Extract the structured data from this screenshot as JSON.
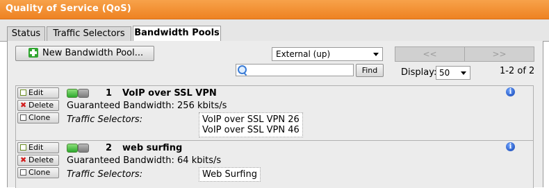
{
  "window": {
    "title": "Quality of Service (QoS)"
  },
  "tabs": [
    {
      "label": "Status"
    },
    {
      "label": "Traffic Selectors"
    },
    {
      "label": "Bandwidth Pools",
      "active": true
    }
  ],
  "toolbar": {
    "new_pool_label": "New Bandwidth Pool...",
    "interface_value": "External (up)",
    "pager_prev": "<<",
    "pager_next": ">>",
    "search_value": "",
    "find_label": "Find",
    "display_label": "Display:",
    "display_value": "50",
    "count": "1-2 of 2"
  },
  "actions": {
    "edit": "Edit",
    "delete": "Delete",
    "clone": "Clone"
  },
  "labels": {
    "traffic_selectors": "Traffic Selectors:"
  },
  "pools": [
    {
      "number": "1",
      "name": "VoIP over SSL VPN",
      "guaranteed": "Guaranteed Bandwidth: 256 kbits/s",
      "selectors": [
        "VoIP over SSL VPN 26",
        "VoIP over SSL VPN 46"
      ]
    },
    {
      "number": "2",
      "name": "web surfing",
      "guaranteed": "Guaranteed Bandwidth: 64 kbits/s",
      "selectors": [
        "Web Surfing"
      ]
    }
  ],
  "colors": {
    "titlebar": "#ee8222",
    "status_on": "#2da92d",
    "status_off": "#7c7c7c",
    "info": "#0d3fb0"
  },
  "icons": [
    "add-icon",
    "search-icon",
    "edit-icon",
    "delete-icon",
    "clone-icon",
    "info-icon",
    "toggle-on-icon",
    "toggle-off-icon"
  ]
}
